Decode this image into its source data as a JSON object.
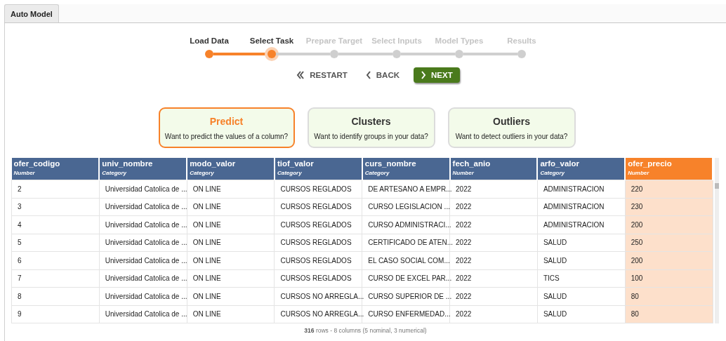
{
  "tabs": [
    {
      "label": "Auto Model",
      "selected": true
    }
  ],
  "steps": [
    {
      "label": "Load Data",
      "completed": true,
      "selected": false
    },
    {
      "label": "Select Task",
      "completed": true,
      "selected": true
    },
    {
      "label": "Prepare Target",
      "completed": false,
      "selected": false
    },
    {
      "label": "Select Inputs",
      "completed": false,
      "selected": false
    },
    {
      "label": "Model Types",
      "completed": false,
      "selected": false
    },
    {
      "label": "Results",
      "completed": false,
      "selected": false
    }
  ],
  "nav_buttons": [
    {
      "label": "RESTART",
      "kind": "restart"
    },
    {
      "label": "BACK",
      "kind": "back"
    },
    {
      "label": "NEXT",
      "kind": "next"
    }
  ],
  "tasks": [
    {
      "title": "Predict",
      "description": "Want to predict the values of a column?",
      "selected": true
    },
    {
      "title": "Clusters",
      "description": "Want to identify groups in your data?",
      "selected": false
    },
    {
      "title": "Outliers",
      "description": "Want to detect outliers in your data?",
      "selected": false
    }
  ],
  "table": {
    "columns": [
      {
        "name": "ofer_codigo",
        "type": "Number",
        "target": false
      },
      {
        "name": "univ_nombre",
        "type": "Category",
        "target": false
      },
      {
        "name": "modo_valor",
        "type": "Category",
        "target": false
      },
      {
        "name": "tiof_valor",
        "type": "Category",
        "target": false
      },
      {
        "name": "curs_nombre",
        "type": "Category",
        "target": false
      },
      {
        "name": "fech_anio",
        "type": "Number",
        "target": false
      },
      {
        "name": "arfo_valor",
        "type": "Category",
        "target": false
      },
      {
        "name": "ofer_precio",
        "type": "Number",
        "target": true
      }
    ],
    "rows": [
      [
        "2",
        "Universidad Catolica de ...",
        "ON LINE",
        "CURSOS REGLADOS",
        "DE ARTESANO A EMPR...",
        "2022",
        "ADMINISTRACION",
        "220"
      ],
      [
        "3",
        "Universidad Catolica de ...",
        "ON LINE",
        "CURSOS REGLADOS",
        "CURSO LEGISLACION ...",
        "2022",
        "ADMINISTRACION",
        "230"
      ],
      [
        "4",
        "Universidad Catolica de ...",
        "ON LINE",
        "CURSOS REGLADOS",
        "CURSO ADMINISTRACI...",
        "2022",
        "ADMINISTRACION",
        "200"
      ],
      [
        "5",
        "Universidad Catolica de ...",
        "ON LINE",
        "CURSOS REGLADOS",
        "CERTIFICADO DE ATEN...",
        "2022",
        "SALUD",
        "250"
      ],
      [
        "6",
        "Universidad Catolica de ...",
        "ON LINE",
        "CURSOS REGLADOS",
        "EL CASO SOCIAL COM...",
        "2022",
        "SALUD",
        "200"
      ],
      [
        "7",
        "Universidad Catolica de ...",
        "ON LINE",
        "CURSOS REGLADOS",
        "CURSO DE EXCEL PAR...",
        "2022",
        "TICS",
        "100"
      ],
      [
        "8",
        "Universidad Catolica de ...",
        "ON LINE",
        "CURSOS NO ARREGLA...",
        "CURSO SUPERIOR DE ...",
        "2022",
        "SALUD",
        "80"
      ],
      [
        "9",
        "Universidad Catolica de ...",
        "ON LINE",
        "CURSOS NO ARREGLA...",
        "CURSO ENFERMEDAD...",
        "2022",
        "SALUD",
        "80"
      ]
    ]
  },
  "summary": "**316** rows - 8 columns (5 nominal, 3 numerical)"
}
